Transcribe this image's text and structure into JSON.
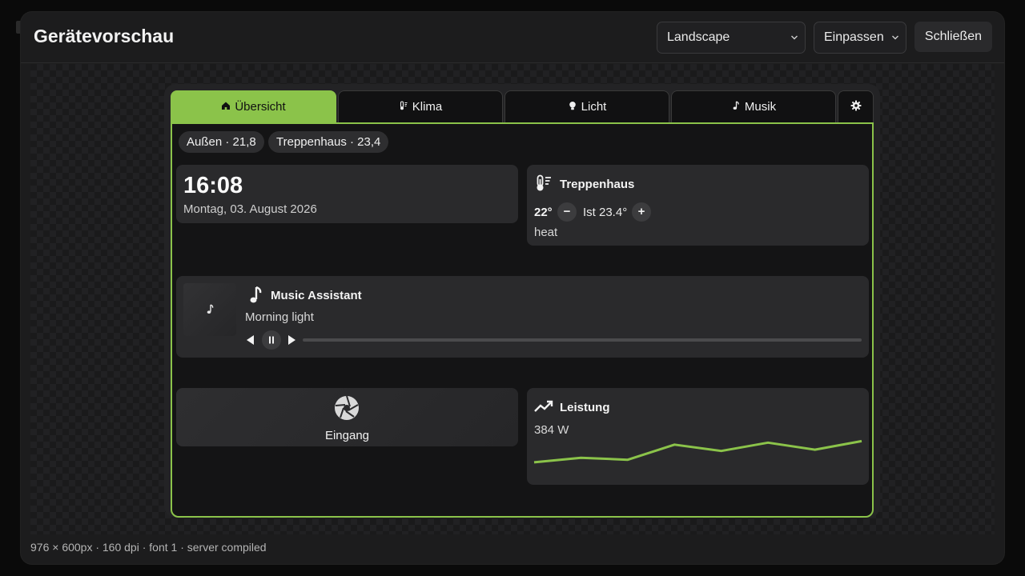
{
  "modal": {
    "title": "Gerätevorschau",
    "orientation": "Landscape",
    "fit": "Einpassen",
    "close_label": "Schließen",
    "footer": "976 × 600px · 160 dpi · font 1 · server compiled"
  },
  "tabs": [
    {
      "label": "Übersicht",
      "icon": "home-icon",
      "active": true
    },
    {
      "label": "Klima",
      "icon": "thermometer-icon",
      "active": false
    },
    {
      "label": "Licht",
      "icon": "bulb-icon",
      "active": false
    },
    {
      "label": "Musik",
      "icon": "music-note-icon",
      "active": false
    },
    {
      "label": "",
      "icon": "gear-icon",
      "active": false
    }
  ],
  "chips": [
    "Außen · 21,8",
    "Treppenhaus · 23,4"
  ],
  "clock": {
    "time": "16:08",
    "date": "Montag, 03. August 2026"
  },
  "climate": {
    "title": "Treppenhaus",
    "target": "22°",
    "minus": "−",
    "current": "Ist 23.4°",
    "plus": "+",
    "mode": "heat"
  },
  "music": {
    "title": "Music Assistant",
    "track": "Morning light",
    "progress": 0
  },
  "camera": {
    "label": "Eingang"
  },
  "power": {
    "title": "Leistung",
    "value": "384 W"
  },
  "chart_data": {
    "type": "line",
    "title": "",
    "xlabel": "",
    "ylabel": "",
    "x": [
      1,
      2,
      3,
      4,
      5,
      6,
      7,
      8
    ],
    "series": [
      {
        "values": [
          300,
          318,
          310,
          370,
          345,
          378,
          350,
          384
        ]
      }
    ],
    "ylim": [
      230,
      420
    ],
    "grid": false,
    "color": "#8bc34a"
  },
  "colors": {
    "accent": "#8bc34a",
    "card": "#2a2a2c",
    "screen": "#141415"
  }
}
